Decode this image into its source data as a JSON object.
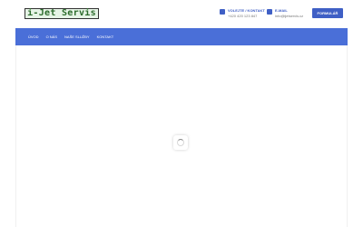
{
  "logo": {
    "text": "i-Jet Servis"
  },
  "header": {
    "phone": {
      "label": "VOLEJTE / KONTAKT",
      "value": "+420 420 123 847",
      "icon": "phone-icon"
    },
    "email": {
      "label": "E-MAIL",
      "value": "info@ijetservis.cz",
      "icon": "mail-icon"
    },
    "form_button": "FORMULÁŘ"
  },
  "nav": {
    "items": [
      "ÚVOD",
      "O NÁS",
      "NAŠE SLUŽBY",
      "KONTAKT"
    ]
  },
  "colors": {
    "accent": "#3f5fc5",
    "nav_bg": "#4a6fd8"
  },
  "loader": {
    "icon": "loading-spinner-icon"
  }
}
